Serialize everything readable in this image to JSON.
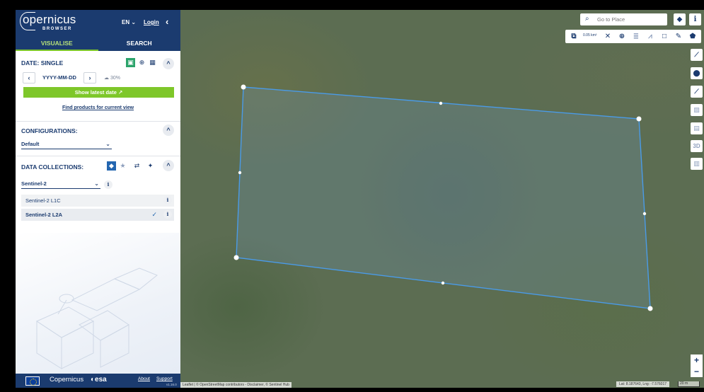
{
  "header": {
    "logo_word": "opernicus",
    "logo_sub": "BROWSER",
    "lang": "EN",
    "lang_chevron": "⌄",
    "login": "Login",
    "collapse": "‹"
  },
  "tabs": [
    {
      "label": "VISUALISE",
      "active": true
    },
    {
      "label": "SEARCH",
      "active": false
    }
  ],
  "date_section": {
    "title": "DATE: SINGLE",
    "date_placeholder": "YYYY-MM-DD",
    "prev": "‹",
    "next": "›",
    "cloud_coverage": "30%",
    "show_latest_label": "Show latest date",
    "find_products_label": "Find products for current view"
  },
  "configurations": {
    "title": "CONFIGURATIONS:",
    "selected": "Default"
  },
  "data_collections": {
    "title": "DATA COLLECTIONS:",
    "selected": "Sentinel-2",
    "items": [
      {
        "label": "Sentinel-2 L1C",
        "selected": false
      },
      {
        "label": "Sentinel-2 L2A",
        "selected": true
      }
    ]
  },
  "footer": {
    "copernicus": "opernicus",
    "esa": "esa",
    "about": "About",
    "support": "Support",
    "version": "v1.16.0"
  },
  "map": {
    "search_placeholder": "Go to Place",
    "area": "0.05 km²",
    "attribution": "Leaflet | © OpenStreetMap contributors - Disclaimer, © Sentinel Hub",
    "coords": "Lat: 8.187643, Lng: -7.576017",
    "scale": "20 m",
    "zoom_in": "+",
    "zoom_out": "−"
  },
  "colors": {
    "brand_navy": "#1b3b6f",
    "accent_green": "#7ec72a",
    "polygon_stroke": "#4a9be8"
  }
}
